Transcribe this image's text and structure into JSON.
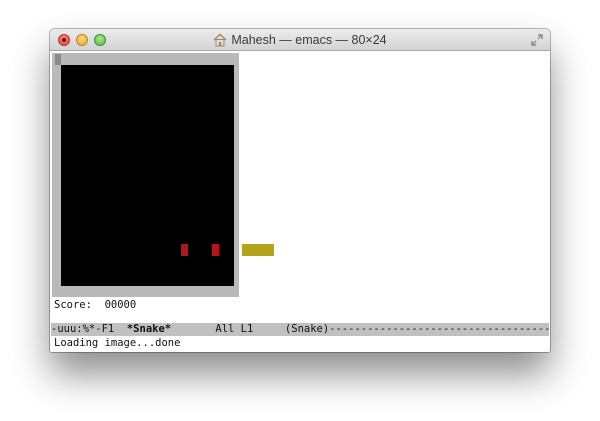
{
  "window": {
    "title": "Mahesh — emacs — 80×24",
    "title_icon": "home-folder-icon",
    "controls": [
      "close-icon",
      "minimize-icon",
      "zoom-icon"
    ],
    "fullscreen_icon": "fullscreen-arrows-icon"
  },
  "game": {
    "score_label": "Score:",
    "score_value": "00000",
    "apples": [
      {
        "col": 11,
        "row": 14
      },
      {
        "col": 14,
        "row": 14
      }
    ],
    "snake": [
      {
        "col": 17,
        "row": 14
      },
      {
        "col": 18,
        "row": 14
      },
      {
        "col": 19,
        "row": 14
      }
    ],
    "colors": {
      "board": "#000000",
      "apple": "#b5141c",
      "snake": "#b3a419",
      "frame": "#b9b9b9"
    }
  },
  "modeline": {
    "status": "-uuu:%*-F1  ",
    "buffer": "*Snake*",
    "position": "       All L1     ",
    "mode": "(Snake)-----------------------------------"
  },
  "echo_area": {
    "message": "Loading image...done"
  }
}
